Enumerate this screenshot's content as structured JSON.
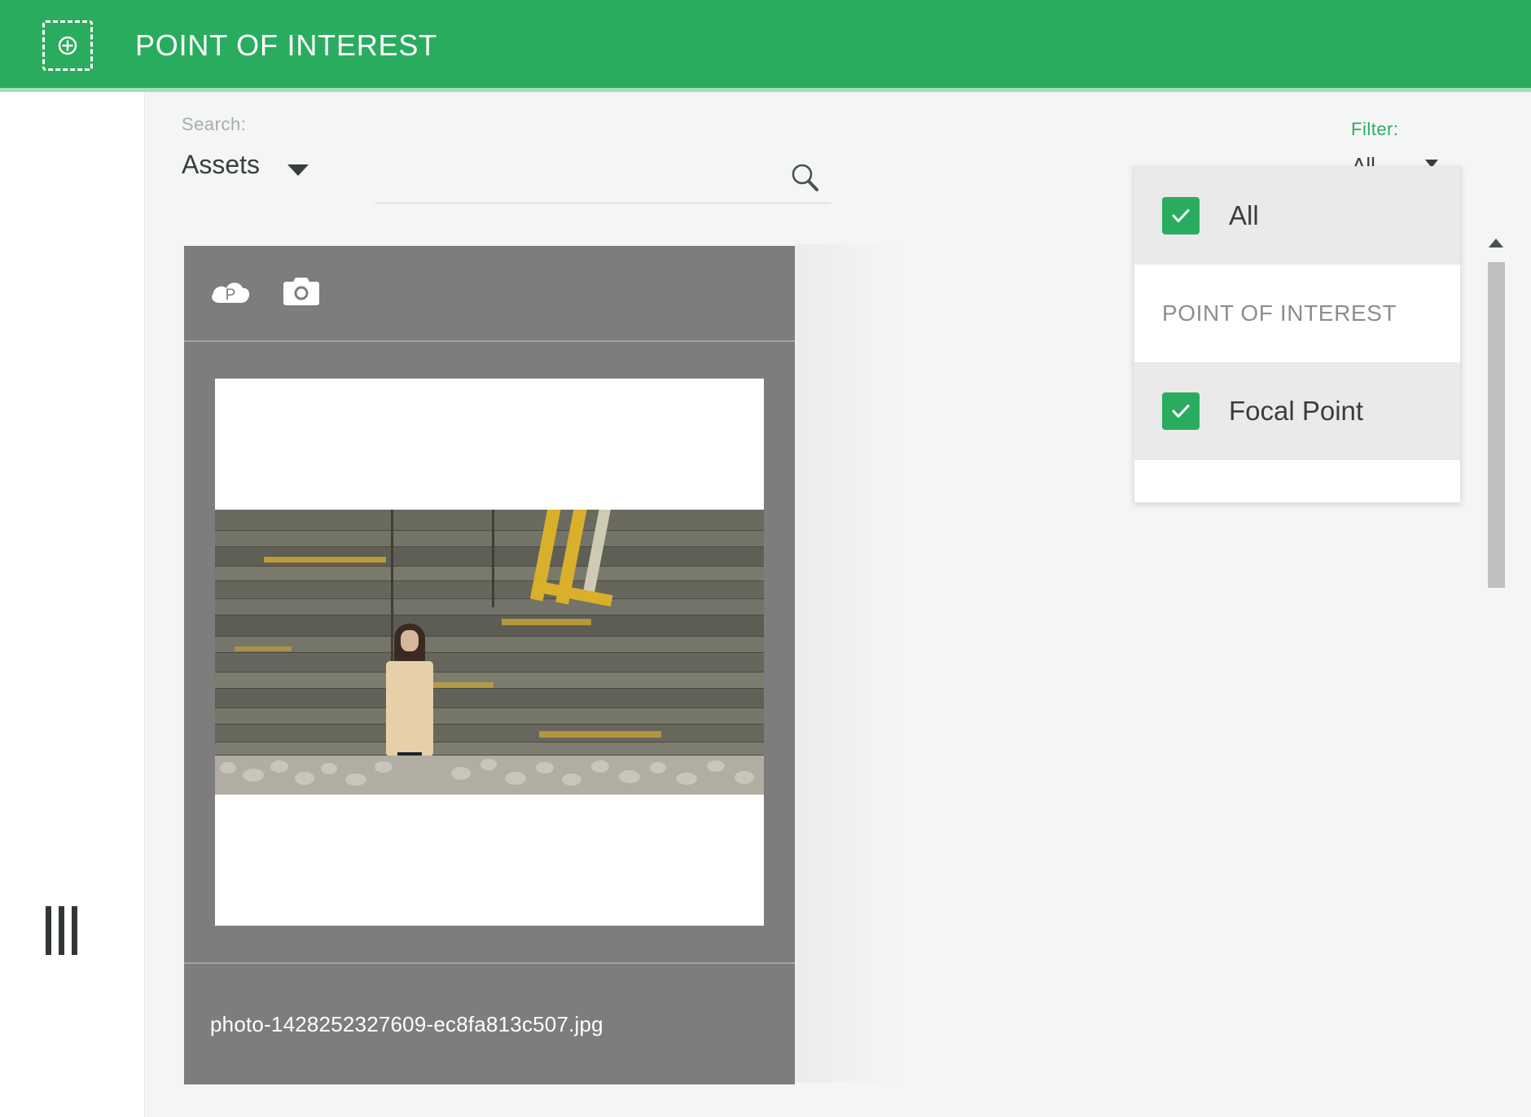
{
  "appbar": {
    "icon": "point-of-interest-target-icon",
    "title": "POINT OF INTEREST"
  },
  "search": {
    "label": "Search:",
    "scope_value": "Assets",
    "scope_caret_icon": "caret-down-icon",
    "input_value": "",
    "input_placeholder": "",
    "search_icon": "search-icon"
  },
  "filter": {
    "label": "Filter:",
    "select_value": "All",
    "caret_icon": "caret-down-icon",
    "panel": {
      "items": [
        {
          "type": "checkbox",
          "label": "All",
          "checked": true,
          "shaded": true
        },
        {
          "type": "group",
          "label": "POINT OF INTEREST",
          "checked": false,
          "shaded": false
        },
        {
          "type": "checkbox",
          "label": "Focal Point",
          "checked": true,
          "shaded": true
        }
      ]
    }
  },
  "sidebar": {
    "handle_icon": "panel-resize-handle-icon"
  },
  "scrollbar": {
    "up_arrow_icon": "scroll-up-arrow-icon",
    "thumb": "scrollbar-thumb"
  },
  "asset_card": {
    "cloud_icon": "cloud-published-p-icon",
    "camera_icon": "camera-icon",
    "filename": "photo-1428252327609-ec8fa813c507.jpg",
    "thumbnail_alt": "woman in beige coat standing against weathered wooden plank wall"
  },
  "colors": {
    "brand_green": "#2aac5f",
    "brand_green_light": "#9fe0bb",
    "card_gray": "#7d7d7d",
    "surface": "#f4f5f5",
    "row_shaded": "#eaeaea",
    "text_dark": "#3a3d3f",
    "text_muted": "#8b8e90"
  }
}
